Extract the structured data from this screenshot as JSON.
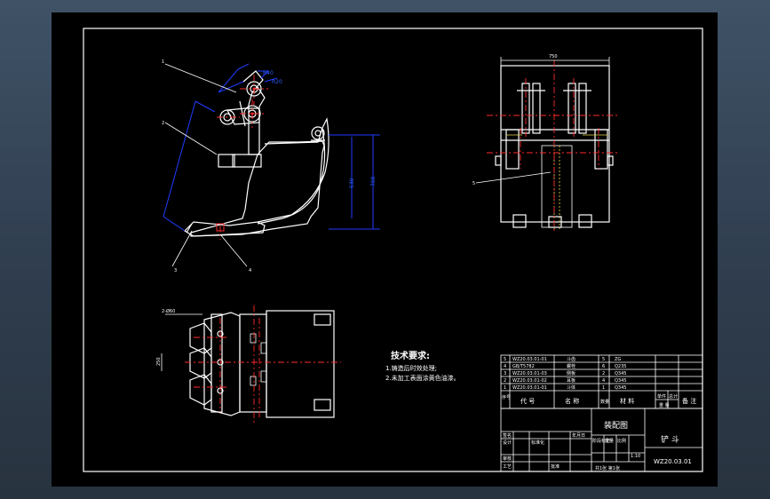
{
  "tech_requirements": {
    "heading": "技术要求:",
    "line1": "1.铸造后时效处理;",
    "line2": "2.未加工表面涂黄色油漆。"
  },
  "callouts": {
    "c1": "1",
    "c2": "2",
    "c3": "3",
    "c4": "4",
    "c5": "5"
  },
  "dimensions": {
    "r40": "R40",
    "r20": "R20",
    "width_top": "750",
    "h_inner": "530",
    "h_outer": "700",
    "hole": "2-Ø60",
    "span": "250"
  },
  "parts_list": [
    {
      "no": "5",
      "code": "WZ20.03.01-01",
      "name": "斗齿",
      "qty": "5",
      "material": "ZG"
    },
    {
      "no": "4",
      "code": "GB/T5782",
      "name": "螺栓",
      "qty": "6",
      "material": "Q235"
    },
    {
      "no": "3",
      "code": "WZ20.03.01-03",
      "name": "侧板",
      "qty": "2",
      "material": "Q345"
    },
    {
      "no": "2",
      "code": "WZ20.03.01-02",
      "name": "耳板",
      "qty": "4",
      "material": "Q345"
    },
    {
      "no": "1",
      "code": "WZ20.03.01-01",
      "name": "斗体",
      "qty": "1",
      "material": "Q345"
    }
  ],
  "parts_header": {
    "no": "序号",
    "code": "代 号",
    "name": "名 称",
    "qty": "数量",
    "material": "材 料",
    "unit_weight": "单件",
    "total_weight": "总计",
    "weight": "重 量",
    "remark": "备 注"
  },
  "title_block": {
    "drawing_type": "装配图",
    "part_name": "铲 斗",
    "drawing_no": "WZ20.03.01",
    "scale": "1:10",
    "sheet": "共1张 第1张",
    "designer": "设计",
    "checker": "审核",
    "approver": "批准",
    "craft": "工艺",
    "std": "标准化",
    "stage": "阶段标记",
    "weight": "重量",
    "ratio": "比例",
    "sign": "签名",
    "date": "年月日"
  }
}
